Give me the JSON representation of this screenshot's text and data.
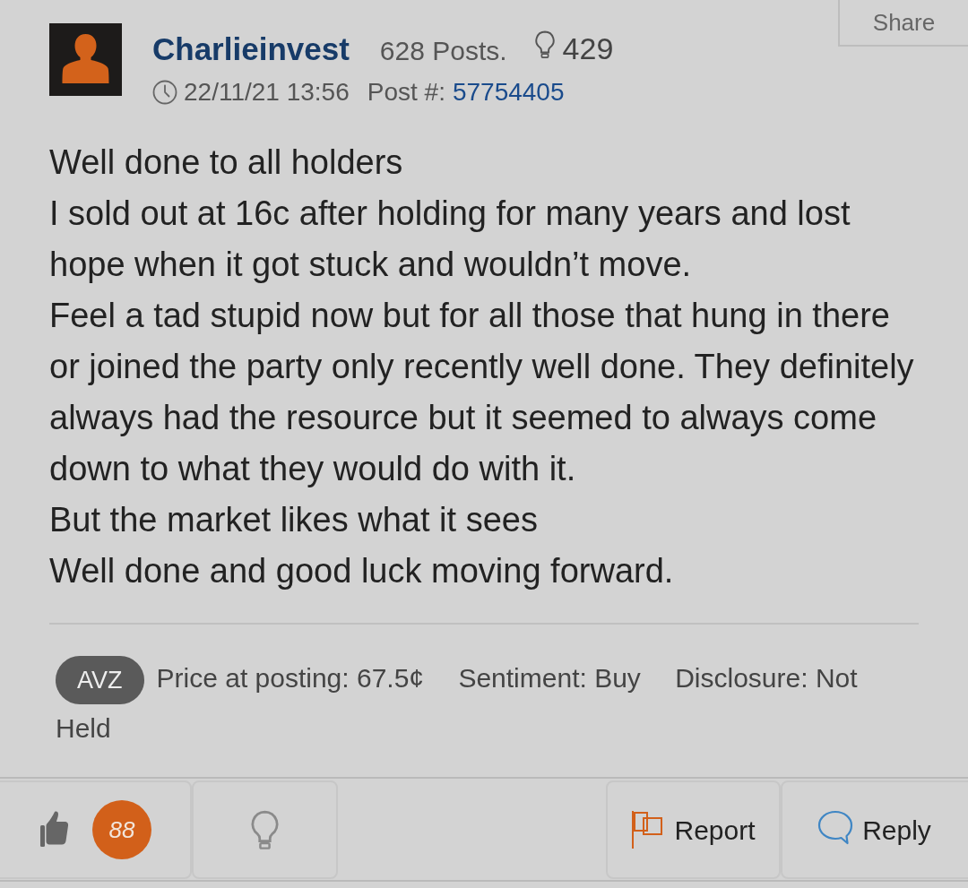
{
  "share_button": "Share",
  "author": {
    "name": "Charlieinvest",
    "posts": "628 Posts.",
    "likes": "429",
    "timestamp": "22/11/21 13:56",
    "post_label": "Post #:",
    "post_number": "57754405"
  },
  "body": [
    "Well done to all holders",
    "I sold out at 16c after holding for many years and lost hope when it got stuck and wouldn’t move.",
    "Feel a tad stupid now but for all those that hung in there or joined the party only recently well done. They definitely always had the resource but it seemed to always come down to what they would do with it.",
    "But the market likes what it sees",
    "Well done and good luck moving forward."
  ],
  "tags": {
    "stock_code": "AVZ",
    "price": "Price at posting: 67.5¢",
    "sentiment": "Sentiment: Buy",
    "disclosure": "Disclosure: Not Held"
  },
  "actions_left": [
    {
      "kind": "like",
      "count": "88"
    },
    {
      "kind": "idea"
    }
  ],
  "actions_right": [
    {
      "kind": "report",
      "label": "Report"
    },
    {
      "kind": "reply",
      "label": "Reply"
    }
  ]
}
